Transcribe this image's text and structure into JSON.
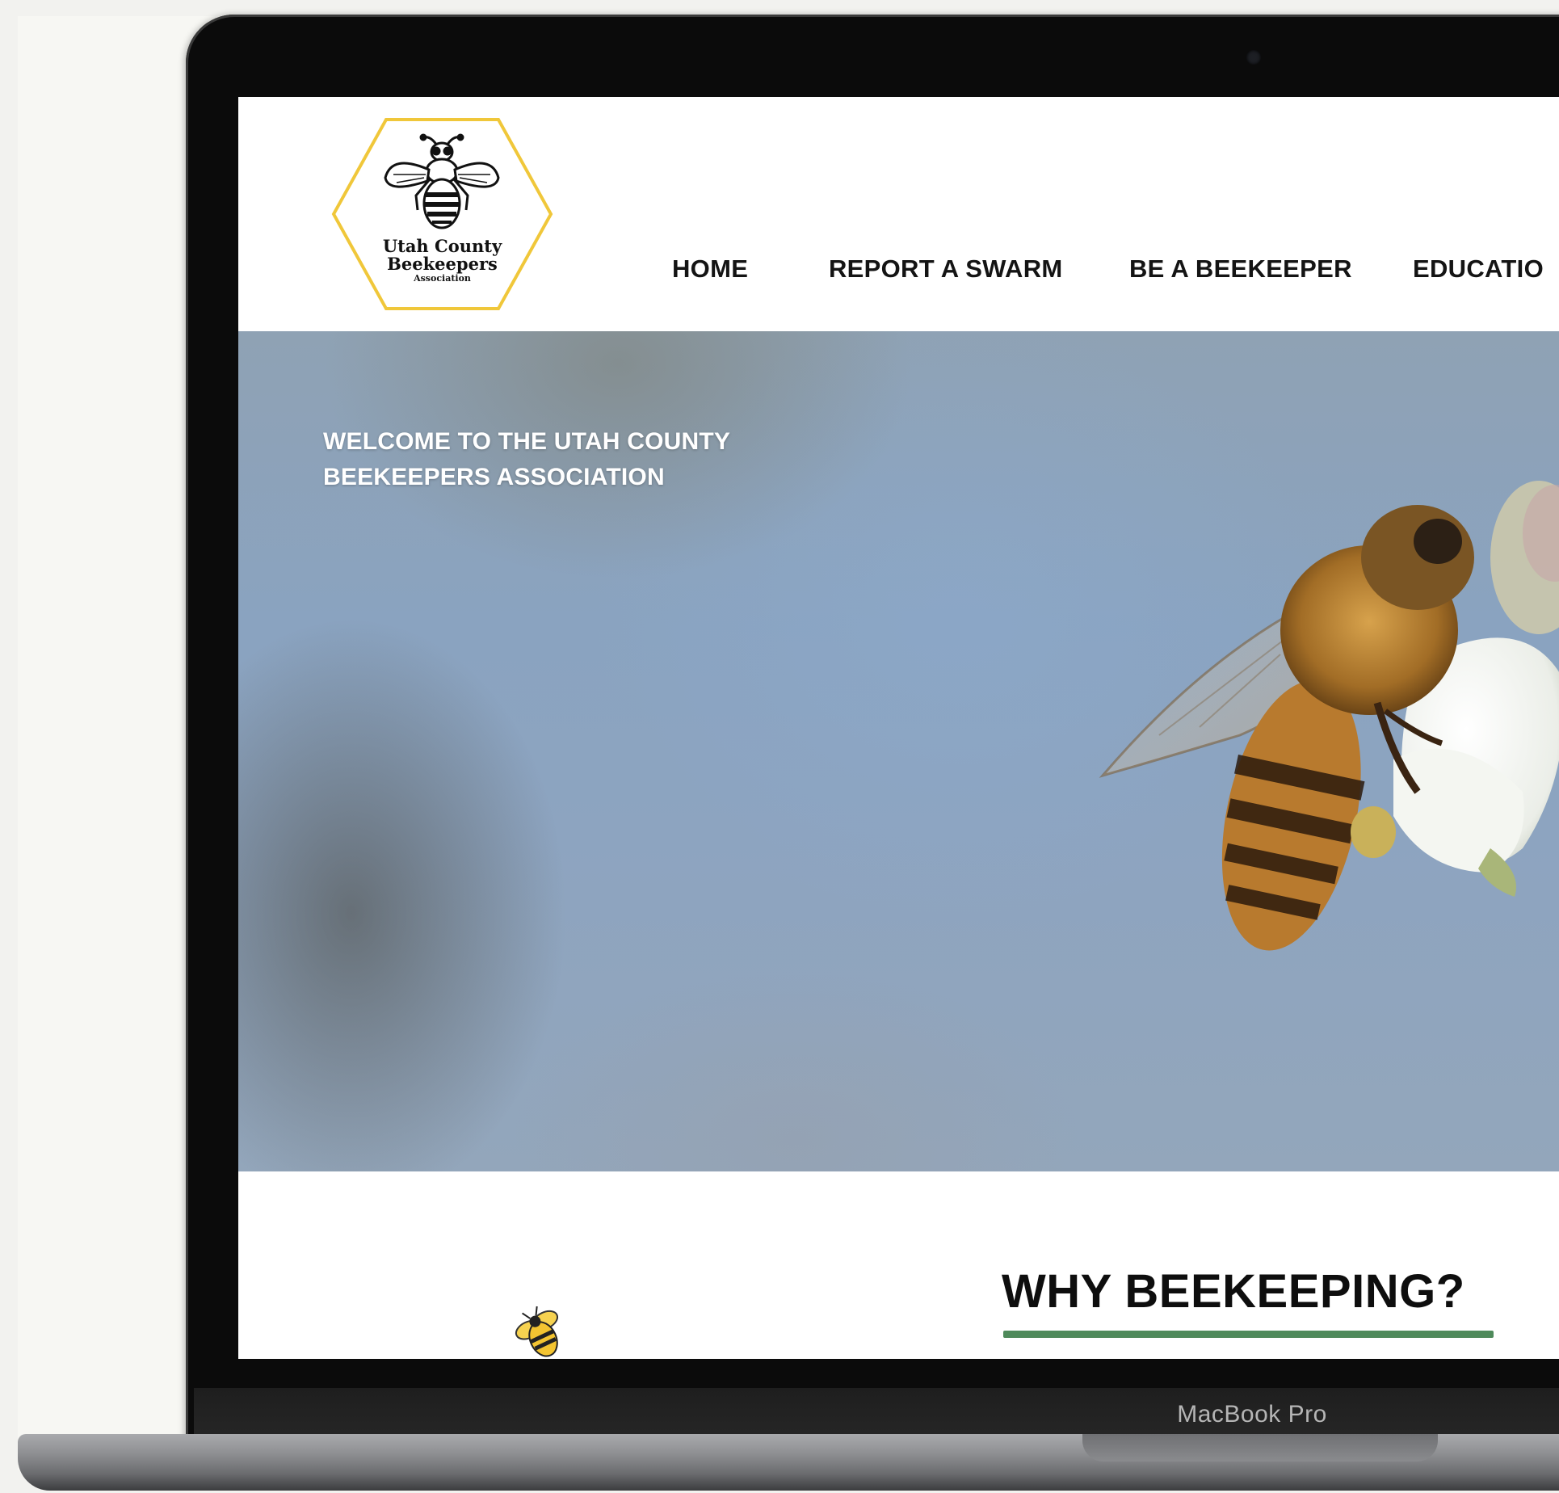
{
  "device": {
    "model_label": "MacBook Pro"
  },
  "site": {
    "logo": {
      "line1": "Utah County",
      "line2": "Beekeepers",
      "line3": "Association",
      "border_color": "#f0c73a"
    },
    "nav": {
      "items": [
        {
          "label": "HOME"
        },
        {
          "label": "REPORT A SWARM"
        },
        {
          "label": "BE A BEEKEEPER"
        },
        {
          "label": "EDUCATIO"
        }
      ]
    },
    "hero": {
      "title": "WELCOME TO THE UTAH COUNTY BEEKEEPERS ASSOCIATION"
    },
    "section": {
      "heading": "WHY BEEKEEPING?",
      "underline_color": "#4f8a5b"
    }
  },
  "icons": {
    "logo_bee": "bee-icon",
    "mini_bee": "bee-icon",
    "camera": "camera-dot"
  }
}
